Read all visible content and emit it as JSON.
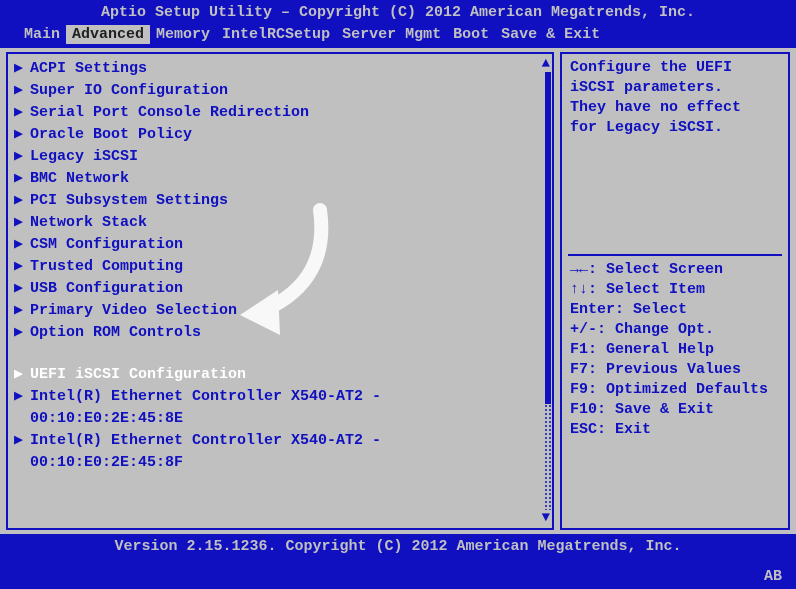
{
  "header": {
    "title": "Aptio Setup Utility – Copyright (C) 2012 American Megatrends, Inc."
  },
  "menubar": {
    "tabs": [
      {
        "label": "Main",
        "active": false
      },
      {
        "label": "Advanced",
        "active": true
      },
      {
        "label": "Memory",
        "active": false
      },
      {
        "label": "IntelRCSetup",
        "active": false
      },
      {
        "label": "Server Mgmt",
        "active": false
      },
      {
        "label": "Boot",
        "active": false
      },
      {
        "label": "Save & Exit",
        "active": false
      }
    ]
  },
  "menu": {
    "items": [
      {
        "label": "ACPI Settings",
        "selected": false,
        "arrow": true
      },
      {
        "label": "Super IO Configuration",
        "selected": false,
        "arrow": true
      },
      {
        "label": "Serial Port Console Redirection",
        "selected": false,
        "arrow": true
      },
      {
        "label": "Oracle Boot Policy",
        "selected": false,
        "arrow": true
      },
      {
        "label": "Legacy iSCSI",
        "selected": false,
        "arrow": true
      },
      {
        "label": "BMC Network",
        "selected": false,
        "arrow": true
      },
      {
        "label": "PCI Subsystem Settings",
        "selected": false,
        "arrow": true
      },
      {
        "label": "Network Stack",
        "selected": false,
        "arrow": true
      },
      {
        "label": "CSM Configuration",
        "selected": false,
        "arrow": true
      },
      {
        "label": "Trusted Computing",
        "selected": false,
        "arrow": true
      },
      {
        "label": "USB Configuration",
        "selected": false,
        "arrow": true
      },
      {
        "label": "Primary Video Selection",
        "selected": false,
        "arrow": true
      },
      {
        "label": "Option ROM Controls",
        "selected": false,
        "arrow": true
      }
    ],
    "blank_after": true,
    "selected_item": {
      "label": "UEFI iSCSI Configuration",
      "arrow": true
    },
    "tail": [
      {
        "label": "Intel(R) Ethernet Controller X540-AT2 -",
        "arrow": true,
        "sub": "00:10:E0:2E:45:8E"
      },
      {
        "label": "Intel(R) Ethernet Controller X540-AT2 -",
        "arrow": true,
        "sub": "00:10:E0:2E:45:8F"
      }
    ]
  },
  "help": {
    "lines": [
      "Configure the UEFI",
      "iSCSI parameters.",
      "They have no effect",
      "for Legacy iSCSI."
    ]
  },
  "keyhelp": {
    "rows": [
      "→←: Select Screen",
      "↑↓: Select Item",
      "Enter: Select",
      "+/-: Change Opt.",
      "F1: General Help",
      "F7: Previous Values",
      "F9: Optimized Defaults",
      "F10: Save & Exit",
      "ESC: Exit"
    ]
  },
  "footer": {
    "text": "Version 2.15.1236. Copyright (C) 2012 American Megatrends, Inc."
  },
  "corner": "AB",
  "overlay": {
    "arrow_color": "#f8f8f8"
  }
}
